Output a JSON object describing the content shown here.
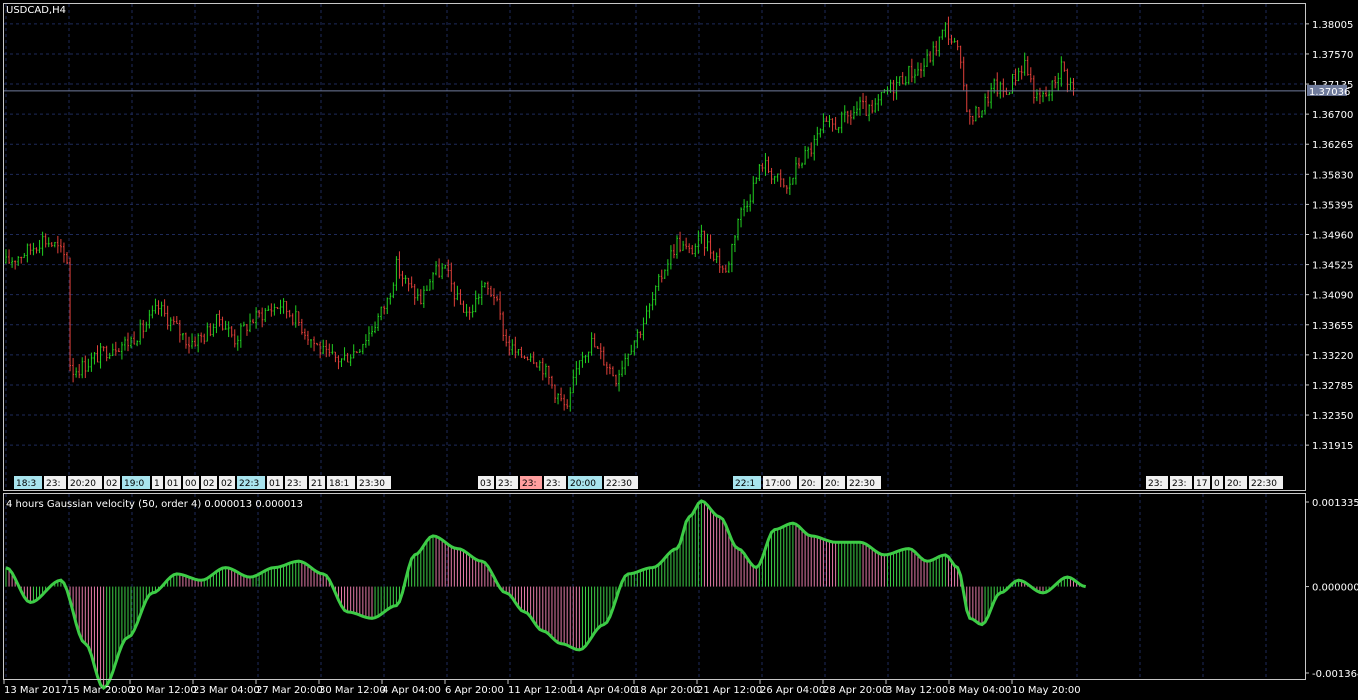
{
  "symbol": "USDCAD,H4",
  "indicator_title": "4 hours Gaussian velocity (50, order 4) 0.000013 0.000013",
  "current_price": "1.37036",
  "colors": {
    "background": "#000000",
    "grid": "#1e2a5a",
    "bull": "#21d021",
    "bear": "#e0403a",
    "up_line": "#3dcc46",
    "down_line": "#e27aa6",
    "frame": "#c8c8c8",
    "price_line": "#6f7b9c",
    "event_bg": "#f0f0f0",
    "event_alt": "#a8e4ee",
    "event_red": "#ff9f9f"
  },
  "price_axis": {
    "ticks": [
      "1.38005",
      "1.37570",
      "1.37135",
      "1.36700",
      "1.36265",
      "1.35830",
      "1.35395",
      "1.34960",
      "1.34525",
      "1.34090",
      "1.33655",
      "1.33220",
      "1.32785",
      "1.32350",
      "1.31915"
    ]
  },
  "indicator_axis": {
    "ticks": [
      "0.001335",
      "0.000000",
      "-0.001364"
    ]
  },
  "time_axis": {
    "labels": [
      "13 Mar 2017",
      "15 Mar 20:00",
      "20 Mar 12:00",
      "23 Mar 04:00",
      "27 Mar 20:00",
      "30 Mar 12:00",
      "4 Apr 04:00",
      "6 Apr 20:00",
      "11 Apr 12:00",
      "14 Apr 04:00",
      "18 Apr 20:00",
      "21 Apr 12:00",
      "26 Apr 04:00",
      "28 Apr 20:00",
      "3 May 12:00",
      "8 May 04:00",
      "10 May 20:00"
    ]
  },
  "events": [
    {
      "group": 1,
      "items": [
        {
          "t": "18:3",
          "s": "alt"
        },
        {
          "t": "23:"
        },
        {
          "t": "20:20"
        },
        {
          "t": "02"
        },
        {
          "t": "19:0",
          "s": "alt"
        },
        {
          "t": "1"
        },
        {
          "t": "01"
        },
        {
          "t": "00"
        },
        {
          "t": "02"
        },
        {
          "t": "02"
        },
        {
          "t": "22:3",
          "s": "alt"
        },
        {
          "t": "01"
        },
        {
          "t": "23:"
        },
        {
          "t": "21"
        },
        {
          "t": "18:1"
        },
        {
          "t": "23:30"
        }
      ]
    },
    {
      "group": 2,
      "items": [
        {
          "t": "03"
        },
        {
          "t": "23:"
        },
        {
          "t": "23:",
          "s": "red"
        },
        {
          "t": "23:"
        },
        {
          "t": "20:00",
          "s": "alt"
        },
        {
          "t": "22:30"
        }
      ]
    },
    {
      "group": 3,
      "items": [
        {
          "t": "22:1",
          "s": "alt"
        },
        {
          "t": "17:00"
        },
        {
          "t": "20:"
        },
        {
          "t": "20:"
        },
        {
          "t": "22:30"
        }
      ]
    },
    {
      "group": 4,
      "items": [
        {
          "t": "23:"
        },
        {
          "t": "23:"
        },
        {
          "t": "17"
        },
        {
          "t": "0"
        },
        {
          "t": "20:"
        },
        {
          "t": "22:30"
        }
      ]
    }
  ],
  "chart_data": [
    {
      "type": "candlestick",
      "title": "USDCAD,H4",
      "ylim": [
        1.317,
        1.3822
      ],
      "current_price": 1.37036,
      "x_labels": [
        "13 Mar 2017",
        "15 Mar 20:00",
        "20 Mar 12:00",
        "23 Mar 04:00",
        "27 Mar 20:00",
        "30 Mar 12:00",
        "4 Apr 04:00",
        "6 Apr 20:00",
        "11 Apr 12:00",
        "14 Apr 04:00",
        "18 Apr 20:00",
        "21 Apr 12:00",
        "26 Apr 04:00",
        "28 Apr 20:00",
        "3 May 12:00",
        "8 May 04:00",
        "10 May 20:00"
      ],
      "close_path": [
        [
          0,
          1.3455
        ],
        [
          4,
          1.3465
        ],
        [
          8,
          1.3475
        ],
        [
          12,
          1.349
        ],
        [
          16,
          1.348
        ],
        [
          18,
          1.347
        ],
        [
          20,
          1.346
        ],
        [
          21,
          1.331
        ],
        [
          22,
          1.33
        ],
        [
          25,
          1.3305
        ],
        [
          30,
          1.332
        ],
        [
          35,
          1.3335
        ],
        [
          40,
          1.334
        ],
        [
          45,
          1.336
        ],
        [
          50,
          1.339
        ],
        [
          55,
          1.3365
        ],
        [
          60,
          1.334
        ],
        [
          65,
          1.335
        ],
        [
          70,
          1.3375
        ],
        [
          75,
          1.3345
        ],
        [
          80,
          1.337
        ],
        [
          85,
          1.3385
        ],
        [
          90,
          1.3395
        ],
        [
          95,
          1.3375
        ],
        [
          100,
          1.3345
        ],
        [
          105,
          1.332
        ],
        [
          110,
          1.3315
        ],
        [
          115,
          1.333
        ],
        [
          120,
          1.336
        ],
        [
          125,
          1.34
        ],
        [
          128,
          1.345
        ],
        [
          132,
          1.342
        ],
        [
          136,
          1.34
        ],
        [
          140,
          1.344
        ],
        [
          144,
          1.3445
        ],
        [
          148,
          1.34
        ],
        [
          152,
          1.338
        ],
        [
          156,
          1.342
        ],
        [
          160,
          1.341
        ],
        [
          164,
          1.334
        ],
        [
          168,
          1.332
        ],
        [
          172,
          1.3325
        ],
        [
          176,
          1.3305
        ],
        [
          180,
          1.327
        ],
        [
          184,
          1.324
        ],
        [
          188,
          1.332
        ],
        [
          192,
          1.334
        ],
        [
          196,
          1.3315
        ],
        [
          200,
          1.329
        ],
        [
          204,
          1.333
        ],
        [
          208,
          1.336
        ],
        [
          212,
          1.34
        ],
        [
          216,
          1.345
        ],
        [
          220,
          1.3485
        ],
        [
          224,
          1.347
        ],
        [
          228,
          1.349
        ],
        [
          232,
          1.347
        ],
        [
          236,
          1.344
        ],
        [
          240,
          1.352
        ],
        [
          244,
          1.3555
        ],
        [
          248,
          1.36
        ],
        [
          252,
          1.358
        ],
        [
          256,
          1.356
        ],
        [
          260,
          1.36
        ],
        [
          264,
          1.362
        ],
        [
          268,
          1.365
        ],
        [
          272,
          1.3655
        ],
        [
          276,
          1.3665
        ],
        [
          280,
          1.368
        ],
        [
          284,
          1.367
        ],
        [
          288,
          1.37
        ],
        [
          292,
          1.3715
        ],
        [
          296,
          1.373
        ],
        [
          300,
          1.3735
        ],
        [
          304,
          1.376
        ],
        [
          308,
          1.3795
        ],
        [
          312,
          1.376
        ],
        [
          316,
          1.366
        ],
        [
          320,
          1.368
        ],
        [
          324,
          1.371
        ],
        [
          328,
          1.37
        ],
        [
          330,
          1.372
        ],
        [
          334,
          1.3745
        ],
        [
          338,
          1.369
        ],
        [
          342,
          1.37
        ],
        [
          346,
          1.374
        ],
        [
          350,
          1.3705
        ]
      ]
    },
    {
      "type": "area",
      "title": "4 hours Gaussian velocity (50, order 4) 0.000013 0.000013",
      "ylim": [
        -0.001364,
        0.001335
      ],
      "x": [
        0,
        8,
        18,
        26,
        32,
        40,
        48,
        56,
        64,
        72,
        80,
        88,
        96,
        104,
        112,
        120,
        128,
        134,
        140,
        148,
        156,
        164,
        170,
        176,
        182,
        188,
        196,
        204,
        212,
        220,
        224,
        228,
        234,
        240,
        246,
        252,
        258,
        264,
        272,
        280,
        288,
        296,
        302,
        308,
        312,
        316,
        320,
        326,
        332,
        340,
        348,
        354
      ],
      "values": [
        0.0003,
        -0.00025,
        0.0001,
        -0.0009,
        -0.0016,
        -0.0008,
        -0.0001,
        0.0002,
        0.0001,
        0.0003,
        0.00015,
        0.0003,
        0.0004,
        0.0002,
        -0.0004,
        -0.0005,
        -0.0003,
        0.0005,
        0.0008,
        0.0006,
        0.0004,
        -0.0001,
        -0.0004,
        -0.0007,
        -0.0009,
        -0.001,
        -0.0006,
        0.0002,
        0.0003,
        0.0006,
        0.0011,
        0.00135,
        0.0011,
        0.0006,
        0.0003,
        0.0009,
        0.001,
        0.0008,
        0.0007,
        0.0007,
        0.0005,
        0.0006,
        0.0004,
        0.0005,
        0.0003,
        -0.0005,
        -0.0006,
        -0.0001,
        0.0001,
        -0.0001,
        0.00015,
        0.0
      ]
    }
  ]
}
